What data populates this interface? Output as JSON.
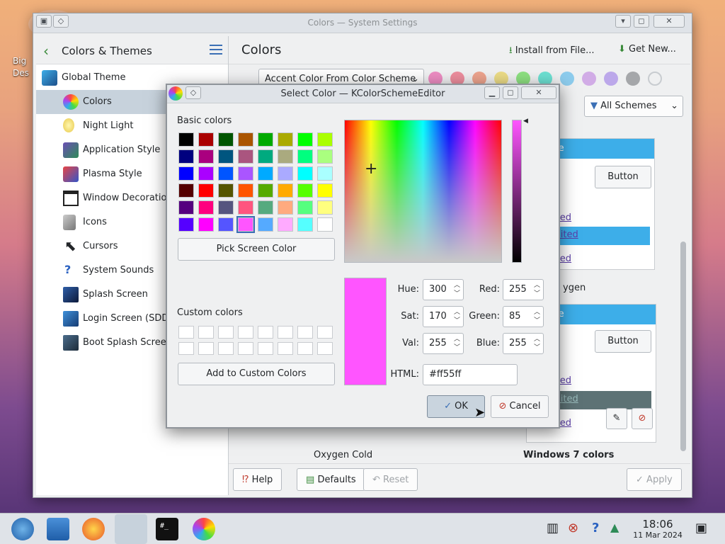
{
  "desktop": {
    "icon_label": "Big Des"
  },
  "window": {
    "title": "Colors — System Settings",
    "buttons": {
      "min": "▾",
      "max": "◻",
      "close": "✕"
    }
  },
  "sidebar": {
    "title": "Colors & Themes",
    "items": [
      {
        "label": "Global Theme"
      },
      {
        "label": "Colors"
      },
      {
        "label": "Night Light"
      },
      {
        "label": "Application Style"
      },
      {
        "label": "Plasma Style"
      },
      {
        "label": "Window Decorations"
      },
      {
        "label": "Icons"
      },
      {
        "label": "Cursors"
      },
      {
        "label": "System Sounds"
      },
      {
        "label": "Splash Screen"
      },
      {
        "label": "Login Screen (SDDM)"
      },
      {
        "label": "Boot Splash Screen"
      }
    ]
  },
  "main": {
    "title": "Colors",
    "install_label": "Install from File...",
    "get_new_label": "Get New...",
    "accent_combo": "Accent Color From Color Scheme",
    "filter_combo": "All Schemes",
    "accent_colors": [
      "#e93a9a",
      "#e93d58",
      "#e9643a",
      "#e8cb2d",
      "#3dd425",
      "#00d3b8",
      "#3daee9",
      "#b875dc",
      "#926ee4",
      "#686b6f"
    ],
    "preview_texts": {
      "window_title": "w Title",
      "button": "Button",
      "link_visited": "visited",
      "link_active": "k visited",
      "link_visited2": "visited",
      "name_oxygen": "ygen"
    },
    "scheme_names": {
      "oxygen_cold": "Oxygen Cold",
      "windows7": "Windows 7 colors"
    }
  },
  "footer": {
    "help": "Help",
    "defaults": "Defaults",
    "reset": "Reset",
    "apply": "Apply"
  },
  "dialog": {
    "title": "Select Color — KColorSchemeEditor",
    "basic_colors_label": "Basic colors",
    "basic_colors": [
      "#000000",
      "#aa0000",
      "#005500",
      "#aa5500",
      "#00aa00",
      "#aaaa00",
      "#00ff00",
      "#aaff00",
      "#00007f",
      "#aa007f",
      "#00557f",
      "#aa557f",
      "#00aa7f",
      "#aaaa7f",
      "#00ff7f",
      "#aaff7f",
      "#0000ff",
      "#aa00ff",
      "#0055ff",
      "#aa55ff",
      "#00aaff",
      "#aaaaff",
      "#00ffff",
      "#aaffff",
      "#550000",
      "#ff0000",
      "#555500",
      "#ff5500",
      "#55aa00",
      "#ffaa00",
      "#55ff00",
      "#ffff00",
      "#55007f",
      "#ff007f",
      "#55557f",
      "#ff557f",
      "#55aa7f",
      "#ffaa7f",
      "#55ff7f",
      "#ffff7f",
      "#5500ff",
      "#ff00ff",
      "#5555ff",
      "#ff55ff",
      "#55aaff",
      "#ffaaff",
      "#55ffff",
      "#ffffff"
    ],
    "pick_screen": "Pick Screen Color",
    "custom_colors_label": "Custom colors",
    "add_custom": "Add to Custom Colors",
    "current_color": "#ff55ff",
    "fields": {
      "hue_label": "Hue:",
      "hue": "300",
      "sat_label": "Sat:",
      "sat": "170",
      "val_label": "Val:",
      "val": "255",
      "red_label": "Red:",
      "red": "255",
      "green_label": "Green:",
      "green": "85",
      "blue_label": "Blue:",
      "blue": "255",
      "html_label": "HTML:",
      "html": "#ff55ff"
    },
    "ok": "OK",
    "cancel": "Cancel"
  },
  "taskbar": {
    "time": "18:06",
    "date": "11 Mar 2024"
  }
}
